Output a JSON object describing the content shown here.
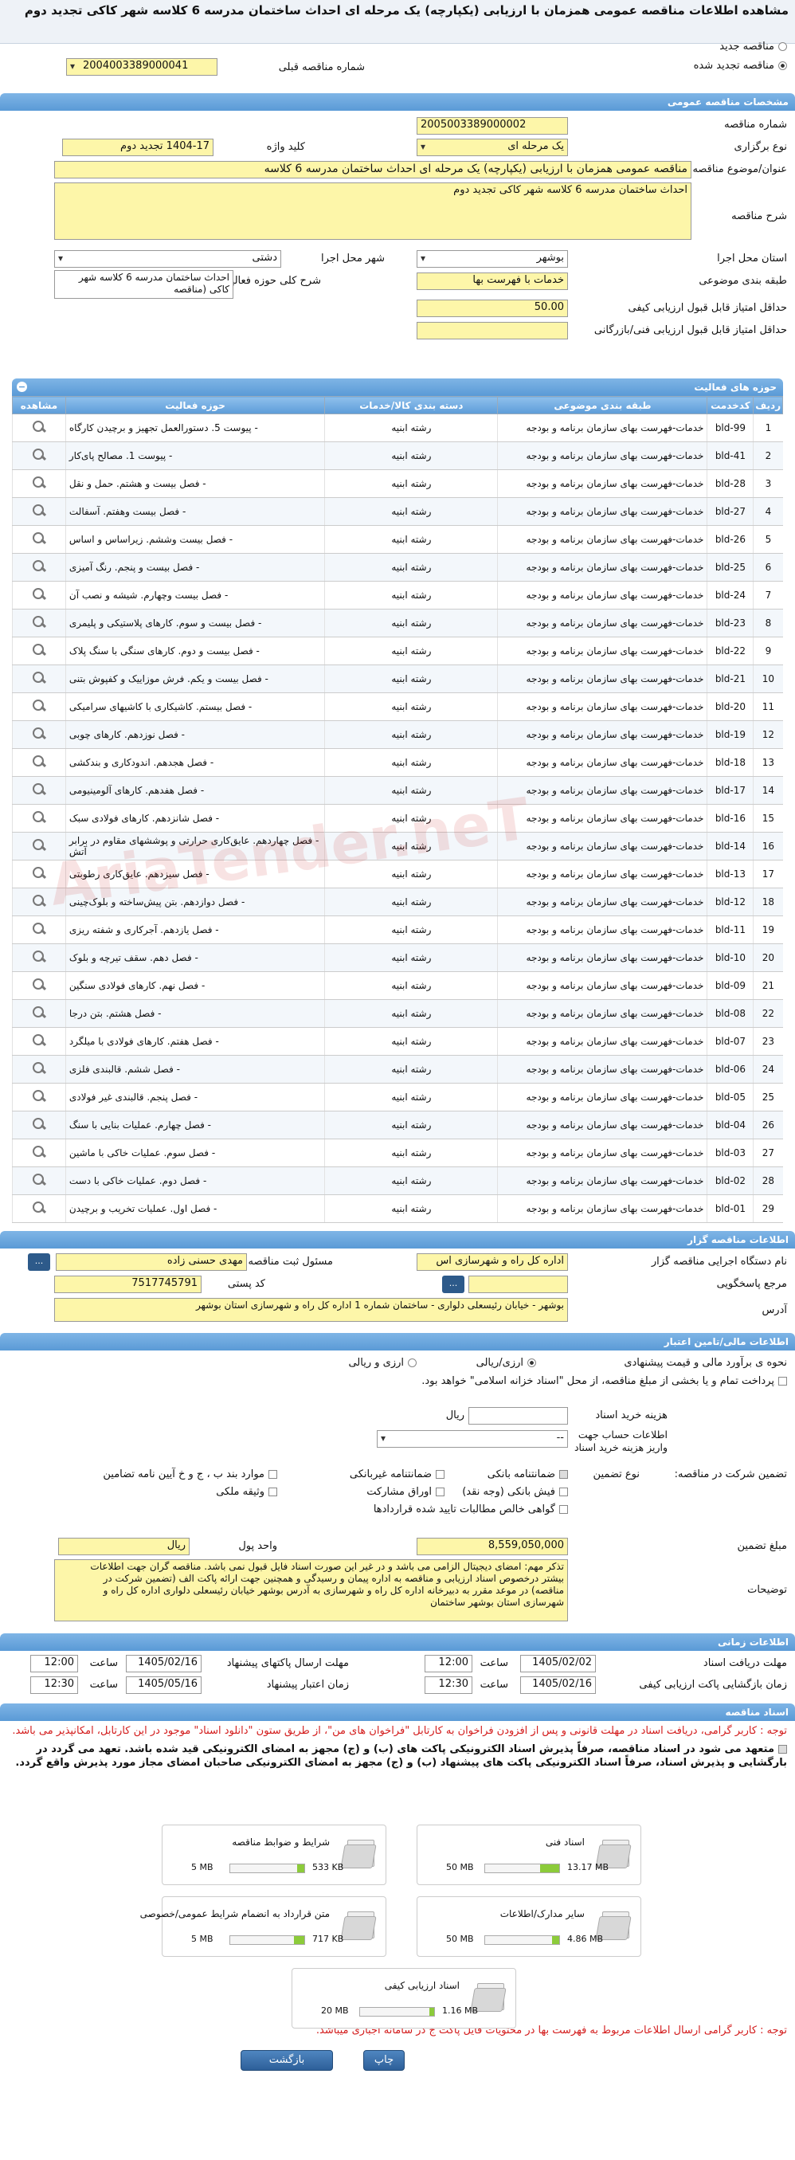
{
  "page_title": "مشاهده اطلاعات مناقصه عمومی همزمان با ارزیابی (یکپارچه) یک مرحله ای احداث ساختمان مدرسه 6 کلاسه شهر کاکی تجدید دوم",
  "top": {
    "new_tender_label": "مناقصه جدید",
    "renewed_label": "مناقصه تجدید شده",
    "prev_number_label": "شماره مناقصه قبلی",
    "prev_number_value": "2004003389000041"
  },
  "general": {
    "header": "مشخصات مناقصه عمومی",
    "tender_number_label": "شماره مناقصه",
    "tender_number_value": "2005003389000002",
    "hold_type_label": "نوع برگزاری",
    "hold_type_value": "یک مرحله ای",
    "keyword_label": "کلید واژه",
    "keyword_value": "1404-17 تجدید دوم",
    "subject_label": "عنوان/موضوع مناقصه",
    "subject_value": "مناقصه عمومی همزمان با ارزیابی (یکپارچه) یک مرحله ای احداث ساختمان مدرسه  6 کلاسه",
    "desc_label": "شرح مناقصه",
    "desc_value": "احداث ساختمان مدرسه  6 کلاسه شهر کاکی تجدید دوم",
    "province_label": "استان محل اجرا",
    "province_value": "بوشهر",
    "city_label": "شهر محل اجرا",
    "city_value": "دشتی",
    "subject_class_label": "طبقه بندی موضوعی",
    "subject_class_value": "خدمات با فهرست بها",
    "activity_scope_label": "شرح کلی حوزه فعالیت",
    "activity_scope_value": "احداث ساختمان مدرسه  6 کلاسه شهر کاکی (مناقصه",
    "min_quality_label": "حداقل امتیاز قابل قبول ارزیابی کیفی",
    "min_quality_value": "50.00",
    "min_tech_label": "حداقل امتیاز قابل قبول ارزیابی فنی/بازرگانی",
    "min_tech_value": ""
  },
  "activities": {
    "header": "حوزه های فعالیت",
    "columns": [
      "ردیف",
      "کدخدمت",
      "طبقه بندی موضوعی",
      "دسته بندی کالا/خدمات",
      "حوزه فعالیت",
      "مشاهده"
    ],
    "rows": [
      [
        "1",
        "bld-99",
        "خدمات-فهرست بهای سازمان برنامه و بودجه",
        "رشته ابنیه",
        "- پیوست 5. دستورالعمل تجهیز و برچیدن کارگاه"
      ],
      [
        "2",
        "bld-41",
        "خدمات-فهرست بهای سازمان برنامه و بودجه",
        "رشته ابنیه",
        "- پیوست 1. مصالح پای‌کار"
      ],
      [
        "3",
        "bld-28",
        "خدمات-فهرست بهای سازمان برنامه و بودجه",
        "رشته ابنیه",
        "- فصل بیست و هشتم. حمل و نقل"
      ],
      [
        "4",
        "bld-27",
        "خدمات-فهرست بهای سازمان برنامه و بودجه",
        "رشته ابنیه",
        "- فصل بیست وهفتم. آسفالت"
      ],
      [
        "5",
        "bld-26",
        "خدمات-فهرست بهای سازمان برنامه و بودجه",
        "رشته ابنیه",
        "- فصل بیست وششم. زیراساس و اساس"
      ],
      [
        "6",
        "bld-25",
        "خدمات-فهرست بهای سازمان برنامه و بودجه",
        "رشته ابنیه",
        "- فصل بیست و پنجم. رنگ آمیزی"
      ],
      [
        "7",
        "bld-24",
        "خدمات-فهرست بهای سازمان برنامه و بودجه",
        "رشته ابنیه",
        "- فصل بیست وچهارم. شیشه و نصب آن"
      ],
      [
        "8",
        "bld-23",
        "خدمات-فهرست بهای سازمان برنامه و بودجه",
        "رشته ابنیه",
        "- فصل بیست و سوم. کارهای پلاستیکی و پلیمری"
      ],
      [
        "9",
        "bld-22",
        "خدمات-فهرست بهای سازمان برنامه و بودجه",
        "رشته ابنیه",
        "- فصل بیست و دوم. کارهای سنگی با سنگ پلاک"
      ],
      [
        "10",
        "bld-21",
        "خدمات-فهرست بهای سازمان برنامه و بودجه",
        "رشته ابنیه",
        "- فصل بیست و یکم. فرش موزاییک و کفپوش بتنی"
      ],
      [
        "11",
        "bld-20",
        "خدمات-فهرست بهای سازمان برنامه و بودجه",
        "رشته ابنیه",
        "- فصل بیستم. کاشیکاری با کاشیهای سرامیکی"
      ],
      [
        "12",
        "bld-19",
        "خدمات-فهرست بهای سازمان برنامه و بودجه",
        "رشته ابنیه",
        "- فصل نوزدهم. کارهای چوبی"
      ],
      [
        "13",
        "bld-18",
        "خدمات-فهرست بهای سازمان برنامه و بودجه",
        "رشته ابنیه",
        "- فصل هجدهم. اندودکاری و بندکشی"
      ],
      [
        "14",
        "bld-17",
        "خدمات-فهرست بهای سازمان برنامه و بودجه",
        "رشته ابنیه",
        "- فصل هفدهم. کارهای آلومینیومی"
      ],
      [
        "15",
        "bld-16",
        "خدمات-فهرست بهای سازمان برنامه و بودجه",
        "رشته ابنیه",
        "- فصل شانزدهم. کارهای فولادی سبک"
      ],
      [
        "16",
        "bld-14",
        "خدمات-فهرست بهای سازمان برنامه و بودجه",
        "رشته ابنیه",
        "- فصل چهاردهم. عایق‌کاری حرارتی و پوششهای مقاوم در برابر آتش"
      ],
      [
        "17",
        "bld-13",
        "خدمات-فهرست بهای سازمان برنامه و بودجه",
        "رشته ابنیه",
        "- فصل سیزدهم. عایق‌کاری رطوبتی"
      ],
      [
        "18",
        "bld-12",
        "خدمات-فهرست بهای سازمان برنامه و بودجه",
        "رشته ابنیه",
        "- فصل دوازدهم. بتن پیش‌ساخته و بلوک‌چینی"
      ],
      [
        "19",
        "bld-11",
        "خدمات-فهرست بهای سازمان برنامه و بودجه",
        "رشته ابنیه",
        "- فصل یازدهم. آجرکاری و شفته ریزی"
      ],
      [
        "20",
        "bld-10",
        "خدمات-فهرست بهای سازمان برنامه و بودجه",
        "رشته ابنیه",
        "- فصل دهم. سقف تیرچه و بلوک"
      ],
      [
        "21",
        "bld-09",
        "خدمات-فهرست بهای سازمان برنامه و بودجه",
        "رشته ابنیه",
        "- فصل نهم. کارهای فولادی سنگین"
      ],
      [
        "22",
        "bld-08",
        "خدمات-فهرست بهای سازمان برنامه و بودجه",
        "رشته ابنیه",
        "- فصل هشتم. بتن درجا"
      ],
      [
        "23",
        "bld-07",
        "خدمات-فهرست بهای سازمان برنامه و بودجه",
        "رشته ابنیه",
        "- فصل هفتم. کارهای فولادی با میلگرد"
      ],
      [
        "24",
        "bld-06",
        "خدمات-فهرست بهای سازمان برنامه و بودجه",
        "رشته ابنیه",
        "- فصل ششم. قالبندی فلزی"
      ],
      [
        "25",
        "bld-05",
        "خدمات-فهرست بهای سازمان برنامه و بودجه",
        "رشته ابنیه",
        "- فصل پنجم. قالبندی غیر فولادی"
      ],
      [
        "26",
        "bld-04",
        "خدمات-فهرست بهای سازمان برنامه و بودجه",
        "رشته ابنیه",
        "- فصل چهارم. عملیات بنایی با سنگ"
      ],
      [
        "27",
        "bld-03",
        "خدمات-فهرست بهای سازمان برنامه و بودجه",
        "رشته ابنیه",
        "- فصل سوم. عملیات خاکی با ماشین"
      ],
      [
        "28",
        "bld-02",
        "خدمات-فهرست بهای سازمان برنامه و بودجه",
        "رشته ابنیه",
        "- فصل دوم. عملیات خاکی با دست"
      ],
      [
        "29",
        "bld-01",
        "خدمات-فهرست بهای سازمان برنامه و بودجه",
        "رشته ابنیه",
        "- فصل اول. عملیات تخریب و برچیدن"
      ]
    ]
  },
  "organizer": {
    "header": "اطلاعات مناقصه گزار",
    "org_label": "نام دستگاه اجرایی مناقصه گزار",
    "org_value": "اداره کل راه و شهرسازی اس",
    "responsible_label": "مسئول ثبت مناقصه",
    "responsible_value": "مهدی حسنی زاده",
    "response_ref_label": "مرجع پاسخگویی",
    "response_ref_value": "",
    "postal_label": "کد پستی",
    "postal_value": "7517745791",
    "address_label": "آدرس",
    "address_value": "بوشهر - خیابان رئیسعلی دلواری - ساختمان شماره 1 اداره کل راه و شهرسازی استان بوشهر",
    "btn_dots": "..."
  },
  "finance": {
    "header": "اطلاعات مالی/تامین اعتبار",
    "estimate_label": "نحوه ی برآورد مالی و قیمت پیشنهادی",
    "opt_rial": "ارزی/ریالی",
    "opt_rial2": "ارزی و ریالی",
    "pay_text": "پرداخت تمام و یا بخشی از مبلغ مناقصه، از محل \"اسناد خزانه اسلامی\" خواهد بود.",
    "doc_cost_label": "هزینه خرید اسناد",
    "doc_cost_unit": "ریال",
    "account_label": "اطلاعات حساب جهت واریز هزینه خرید اسناد",
    "account_value": "--",
    "guarantee_label": "تضمین شرکت در مناقصه:",
    "guarantee_type_label": "نوع تضمین",
    "g1": "ضمانتنامه بانکی",
    "g2": "ضمانتنامه غیربانکی",
    "g3": "موارد بند ب ، ج و خ آیین نامه تضامین",
    "g4": "فیش بانکی (وجه نقد)",
    "g5": "اوراق مشارکت",
    "g6": "وثیقه ملکی",
    "g7": "گواهی خالص مطالبات تایید شده قراردادها",
    "amount_label": "مبلغ تضمین",
    "amount_value": "8,559,050,000",
    "currency_label": "واحد پول",
    "currency_value": "ریال",
    "desc_label": "توضیحات",
    "desc_value": "تذکر مهم: امضای دیجیتال الزامی می باشد و در غیر این صورت اسناد فایل قبول نمی باشد. مناقصه گران جهت اطلاعات بیشتر درخصوص اسناد ارزیابی و مناقصه به اداره پیمان و رسیدگی و همچنین جهت ارائه پاکت الف (تضمین شرکت در مناقصه) در موعد مقرر به دبیرخانه اداره کل راه و شهرسازی به آدرس بوشهر خیابان رئیسعلی دلواری اداره کل راه و شهرسازی استان بوشهر ساختمان"
  },
  "timing": {
    "header": "اطلاعات زمانی",
    "receive_label": "مهلت دریافت اسناد",
    "receive_date": "1405/02/02",
    "receive_time": "12:00",
    "send_label": "مهلت ارسال پاکتهای پیشنهاد",
    "send_date": "1405/02/16",
    "send_time": "12:00",
    "open_label": "زمان بازگشایی پاکت ارزیابی کیفی",
    "open_date": "1405/02/16",
    "open_time": "12:30",
    "validity_label": "زمان اعتبار پیشنهاد",
    "validity_date": "1405/05/16",
    "validity_time": "12:30",
    "time_label": "ساعت"
  },
  "docs": {
    "header": "اسناد مناقصه",
    "note1": "توجه : کاربر گرامی، دریافت اسناد در مهلت قانونی و پس از افزودن فراخوان به کارتابل \"فراخوان های من\"، از طریق ستون \"دانلود اسناد\" موجود در این کارتابل، امکانپذیر می باشد.",
    "note2": "متعهد می شود در اسناد مناقصه، صرفاً پذیرش اسناد الکترونیکی پاکت های (ب) و (ج) مجهز به امضای الکترونیکی قید شده باشد. تعهد می گردد در بارگشایی و پذیرش اسناد، صرفاً اسناد الکترونیکی پاکت های پیشنهاد (ب) و (ج) مجهز به امضای الکترونیکی صاحبان امضای مجاز مورد پذیرش واقع گردد.",
    "items": [
      {
        "title": "شرایط و ضوابط مناقصه",
        "max": "5 MB",
        "cur": "533 KB",
        "pct": 10
      },
      {
        "title": "اسناد فنی",
        "max": "50 MB",
        "cur": "13.17 MB",
        "pct": 26
      },
      {
        "title": "متن قرارداد به انضمام شرایط عمومی/خصوصی",
        "max": "5 MB",
        "cur": "717 KB",
        "pct": 14
      },
      {
        "title": "سایر مدارک/اطلاعات",
        "max": "50 MB",
        "cur": "4.86 MB",
        "pct": 10
      },
      {
        "title": "اسناد ارزیابی کیفی",
        "max": "20 MB",
        "cur": "1.16 MB",
        "pct": 6
      }
    ],
    "note3": "توجه : کاربر گرامی ارسال اطلاعات مربوط به فهرست بها در محتویات فایل پاکت ج در سامانه اجباری میباشد."
  },
  "buttons": {
    "back": "بازگشت",
    "print": "چاپ"
  },
  "watermark": "AriaTender.neT"
}
